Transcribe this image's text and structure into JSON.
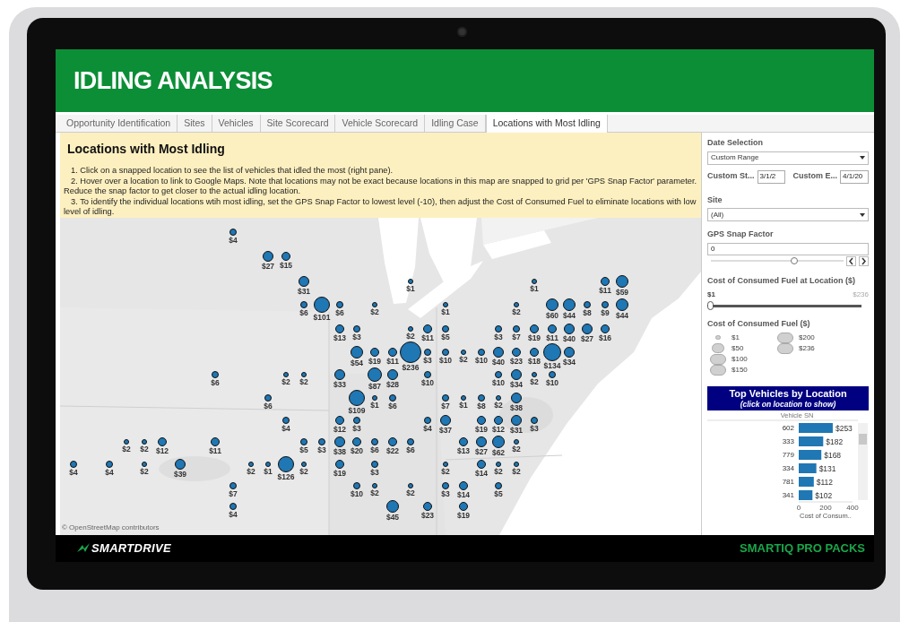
{
  "header": {
    "title": "IDLING ANALYSIS"
  },
  "tabs": [
    {
      "label": "Opportunity Identification",
      "selected": false
    },
    {
      "label": "Sites",
      "selected": false
    },
    {
      "label": "Vehicles",
      "selected": false
    },
    {
      "label": "Site Scorecard",
      "selected": false
    },
    {
      "label": "Vehicle Scorecard",
      "selected": false
    },
    {
      "label": "Idling Case",
      "selected": false
    },
    {
      "label": "Locations with Most Idling",
      "selected": true
    }
  ],
  "instructions": {
    "title": "Locations with Most Idling",
    "steps": [
      "1. Click on a snapped location to see the list of vehicles that idled the most (right pane).",
      "2. Hover over a location to link to Google Maps.  Note that locations may not be exact because locations in this map are snapped to grid per 'GPS Snap Factor' parameter.  Reduce the snap factor to get closer to the actual idling location.",
      "3. To identify the individual locations wtih most idling, set the GPS Snap Factor to lowest level (-10), then adjust the Cost of Consumed Fuel to eliminate locations with low level of idling."
    ]
  },
  "map": {
    "attribution": "© OpenStreetMap contributors",
    "locations": [
      {
        "value": "$4"
      },
      {
        "value": "$27"
      },
      {
        "value": "$15"
      },
      {
        "value": "$31"
      },
      {
        "value": "$1"
      },
      {
        "value": "$1"
      },
      {
        "value": "$11"
      },
      {
        "value": "$59"
      },
      {
        "value": "$6"
      },
      {
        "value": "$101"
      },
      {
        "value": "$6"
      },
      {
        "value": "$2"
      },
      {
        "value": "$1"
      },
      {
        "value": "$2"
      },
      {
        "value": "$60"
      },
      {
        "value": "$44"
      },
      {
        "value": "$8"
      },
      {
        "value": "$9"
      },
      {
        "value": "$44"
      },
      {
        "value": "$13"
      },
      {
        "value": "$3"
      },
      {
        "value": "$2"
      },
      {
        "value": "$11"
      },
      {
        "value": "$5"
      },
      {
        "value": "$3"
      },
      {
        "value": "$7"
      },
      {
        "value": "$19"
      },
      {
        "value": "$11"
      },
      {
        "value": "$40"
      },
      {
        "value": "$27"
      },
      {
        "value": "$16"
      },
      {
        "value": "$54"
      },
      {
        "value": "$19"
      },
      {
        "value": "$11"
      },
      {
        "value": "$236"
      },
      {
        "value": "$3"
      },
      {
        "value": "$10"
      },
      {
        "value": "$2"
      },
      {
        "value": "$10"
      },
      {
        "value": "$40"
      },
      {
        "value": "$23"
      },
      {
        "value": "$18"
      },
      {
        "value": "$134"
      },
      {
        "value": "$34"
      },
      {
        "value": "$6"
      },
      {
        "value": "$2"
      },
      {
        "value": "$2"
      },
      {
        "value": "$33"
      },
      {
        "value": "$87"
      },
      {
        "value": "$28"
      },
      {
        "value": "$10"
      },
      {
        "value": "$10"
      },
      {
        "value": "$34"
      },
      {
        "value": "$2"
      },
      {
        "value": "$10"
      },
      {
        "value": "$6"
      },
      {
        "value": "$109"
      },
      {
        "value": "$1"
      },
      {
        "value": "$6"
      },
      {
        "value": "$7"
      },
      {
        "value": "$1"
      },
      {
        "value": "$8"
      },
      {
        "value": "$2"
      },
      {
        "value": "$38"
      },
      {
        "value": "$4"
      },
      {
        "value": "$12"
      },
      {
        "value": "$3"
      },
      {
        "value": "$4"
      },
      {
        "value": "$37"
      },
      {
        "value": "$19"
      },
      {
        "value": "$12"
      },
      {
        "value": "$31"
      },
      {
        "value": "$3"
      },
      {
        "value": "$2"
      },
      {
        "value": "$2"
      },
      {
        "value": "$12"
      },
      {
        "value": "$11"
      },
      {
        "value": "$5"
      },
      {
        "value": "$3"
      },
      {
        "value": "$38"
      },
      {
        "value": "$20"
      },
      {
        "value": "$6"
      },
      {
        "value": "$22"
      },
      {
        "value": "$6"
      },
      {
        "value": "$13"
      },
      {
        "value": "$27"
      },
      {
        "value": "$62"
      },
      {
        "value": "$2"
      },
      {
        "value": "$4"
      },
      {
        "value": "$4"
      },
      {
        "value": "$2"
      },
      {
        "value": "$39"
      },
      {
        "value": "$2"
      },
      {
        "value": "$1"
      },
      {
        "value": "$126"
      },
      {
        "value": "$2"
      },
      {
        "value": "$19"
      },
      {
        "value": "$3"
      },
      {
        "value": "$2"
      },
      {
        "value": "$14"
      },
      {
        "value": "$2"
      },
      {
        "value": "$2"
      },
      {
        "value": "$7"
      },
      {
        "value": "$10"
      },
      {
        "value": "$2"
      },
      {
        "value": "$2"
      },
      {
        "value": "$3"
      },
      {
        "value": "$14"
      },
      {
        "value": "$5"
      },
      {
        "value": "$4"
      },
      {
        "value": "$45"
      },
      {
        "value": "$23"
      },
      {
        "value": "$19"
      }
    ]
  },
  "filters": {
    "date_selection": {
      "label": "Date Selection",
      "value": "Custom Range"
    },
    "custom_start": {
      "label": "Custom St...",
      "value": "3/1/2"
    },
    "custom_end": {
      "label": "Custom E...",
      "value": "4/1/20"
    },
    "site": {
      "label": "Site",
      "value": "(All)"
    },
    "gps_snap": {
      "label": "GPS Snap Factor",
      "value": "0",
      "level": 0.63
    },
    "cost_range": {
      "label": "Cost of Consumed Fuel at Location ($)",
      "min": "$1",
      "max": "$236",
      "level": 0
    }
  },
  "size_legend": {
    "title": "Cost of Consumed Fuel ($)",
    "items": [
      "$1",
      "$50",
      "$100",
      "$150",
      "$200",
      "$236"
    ]
  },
  "top_vehicles": {
    "title": "Top Vehicles by Location",
    "subtitle": "(click on location to show)",
    "chart_data": {
      "type": "bar",
      "orientation": "horizontal",
      "ylabel": "Vehicle SN",
      "xlabel": "Cost of Consum..",
      "categories": [
        "602",
        "333",
        "779",
        "334",
        "781",
        "341"
      ],
      "values": [
        253,
        182,
        168,
        131,
        112,
        102
      ],
      "xlim": [
        0,
        400
      ],
      "xticks": [
        0,
        200,
        400
      ],
      "value_labels": [
        "$253",
        "$182",
        "$168",
        "$131",
        "$112",
        "$102"
      ]
    }
  },
  "footer": {
    "logo": "SMARTDRIVE",
    "product": "SMARTIQ PRO PACKS"
  }
}
